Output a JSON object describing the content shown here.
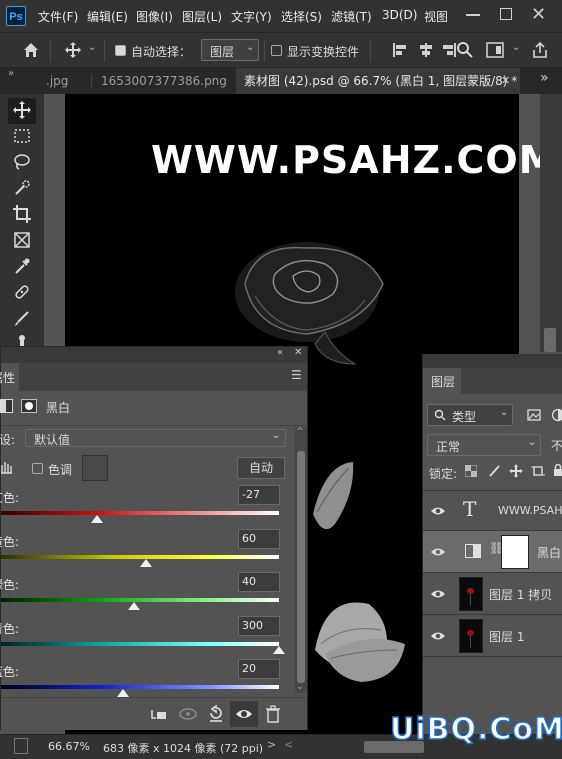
{
  "app": {
    "logo": "Ps"
  },
  "menu": {
    "items": [
      "文件(F)",
      "编辑(E)",
      "图像(I)",
      "图层(L)",
      "文字(Y)",
      "选择(S)",
      "滤镜(T)",
      "3D(D)",
      "视图"
    ]
  },
  "options": {
    "auto_select_label": "自动选择：",
    "auto_select_target": "图层",
    "show_transform_label": "显示变换控件"
  },
  "tabs": [
    {
      "label": ".jpg"
    },
    {
      "label": "1653007377386.png"
    },
    {
      "label": "素材图 (42).psd @ 66.7% (黑白 1, 图层蒙版/8) *",
      "active": true
    }
  ],
  "canvas": {
    "watermark_text": "WWW.PSAHZ.COM"
  },
  "properties": {
    "tab_label": "属性",
    "adjustment_name": "黑白",
    "preset_label": "预设:",
    "preset_value": "默认值",
    "tint_label": "色调",
    "auto_button": "自动",
    "sliders": [
      {
        "label": "红色:",
        "value": "-27",
        "track_color": "red"
      },
      {
        "label": "黄色:",
        "value": "60",
        "track_color": "yellow"
      },
      {
        "label": "绿色:",
        "value": "40",
        "track_color": "green"
      },
      {
        "label": "青色:",
        "value": "300",
        "track_color": "cyan"
      },
      {
        "label": "蓝色:",
        "value": "20",
        "track_color": "blue"
      }
    ]
  },
  "layers": {
    "tab_label": "图层",
    "filter_kind": "类型",
    "blend_mode": "正常",
    "opacity_label": "不",
    "lock_label": "锁定:",
    "items": [
      {
        "name": "WWW.PSAHZ",
        "kind": "text"
      },
      {
        "name": "黑白",
        "kind": "adjustment"
      },
      {
        "name": "图层 1 拷贝",
        "kind": "pixel"
      },
      {
        "name": "图层 1",
        "kind": "pixel"
      }
    ]
  },
  "status": {
    "zoom": "66.67%",
    "doc_info": "683 像素 x 1024 像素 (72 ppi)"
  },
  "site_watermark": "UiBQ.CoM"
}
